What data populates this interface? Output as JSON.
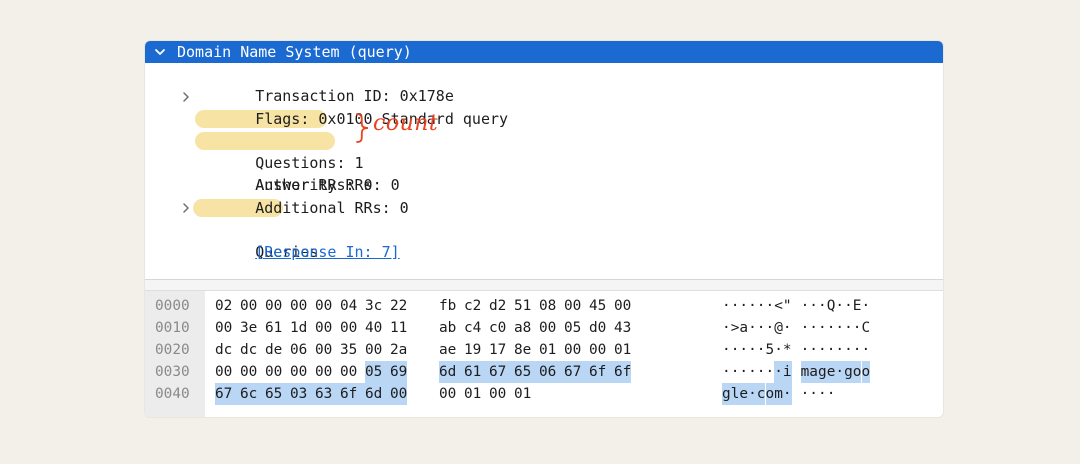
{
  "tree": {
    "header": "Domain Name System (query)",
    "rows": [
      {
        "text": "Transaction ID: 0x178e",
        "expandable": false
      },
      {
        "text": "Flags: 0x0100 Standard query",
        "expandable": true
      },
      {
        "text": "Questions: 1",
        "expandable": false,
        "highlighted": true
      },
      {
        "text": "Answer RRs: 0",
        "expandable": false,
        "highlighted": true
      },
      {
        "text": "Authority RRs: 0",
        "expandable": false
      },
      {
        "text": "Additional RRs: 0",
        "expandable": false
      },
      {
        "text": "Queries",
        "expandable": true,
        "highlighted": true
      },
      {
        "text": "[Response In: 7]",
        "expandable": false,
        "link": true
      }
    ],
    "annotation": "count"
  },
  "hex": {
    "rows": [
      {
        "offset": "0000",
        "bytes": [
          "02",
          "00",
          "00",
          "00",
          "00",
          "04",
          "3c",
          "22",
          "fb",
          "c2",
          "d2",
          "51",
          "08",
          "00",
          "45",
          "00"
        ],
        "ascii": [
          "·",
          "·",
          "·",
          "·",
          "·",
          "·",
          "<",
          "\"",
          "·",
          "·",
          "·",
          "Q",
          "·",
          "·",
          "E",
          "·"
        ]
      },
      {
        "offset": "0010",
        "bytes": [
          "00",
          "3e",
          "61",
          "1d",
          "00",
          "00",
          "40",
          "11",
          "ab",
          "c4",
          "c0",
          "a8",
          "00",
          "05",
          "d0",
          "43"
        ],
        "ascii": [
          "·",
          ">",
          "a",
          "·",
          "·",
          "·",
          "@",
          "·",
          "·",
          "·",
          "·",
          "·",
          "·",
          "·",
          "·",
          "C"
        ]
      },
      {
        "offset": "0020",
        "bytes": [
          "dc",
          "dc",
          "de",
          "06",
          "00",
          "35",
          "00",
          "2a",
          "ae",
          "19",
          "17",
          "8e",
          "01",
          "00",
          "00",
          "01"
        ],
        "ascii": [
          "·",
          "·",
          "·",
          "·",
          "·",
          "5",
          "·",
          "*",
          "·",
          "·",
          "·",
          "·",
          "·",
          "·",
          "·",
          "·"
        ]
      },
      {
        "offset": "0030",
        "bytes": [
          "00",
          "00",
          "00",
          "00",
          "00",
          "00",
          "05",
          "69",
          "6d",
          "61",
          "67",
          "65",
          "06",
          "67",
          "6f",
          "6f"
        ],
        "ascii": [
          "·",
          "·",
          "·",
          "·",
          "·",
          "·",
          "·",
          "i",
          "m",
          "a",
          "g",
          "e",
          "·",
          "g",
          "o",
          "o"
        ]
      },
      {
        "offset": "0040",
        "bytes": [
          "67",
          "6c",
          "65",
          "03",
          "63",
          "6f",
          "6d",
          "00",
          "00",
          "01",
          "00",
          "01"
        ],
        "ascii": [
          "g",
          "l",
          "e",
          "·",
          "c",
          "o",
          "m",
          "·",
          "·",
          "·",
          "·",
          "·"
        ]
      }
    ],
    "selected_start": 54,
    "selected_end": 71
  },
  "colors": {
    "header_bg": "#1a6ad1",
    "highlight": "#f5dc8c",
    "selection": "#b9d6f5",
    "annotation": "#e8421f"
  }
}
